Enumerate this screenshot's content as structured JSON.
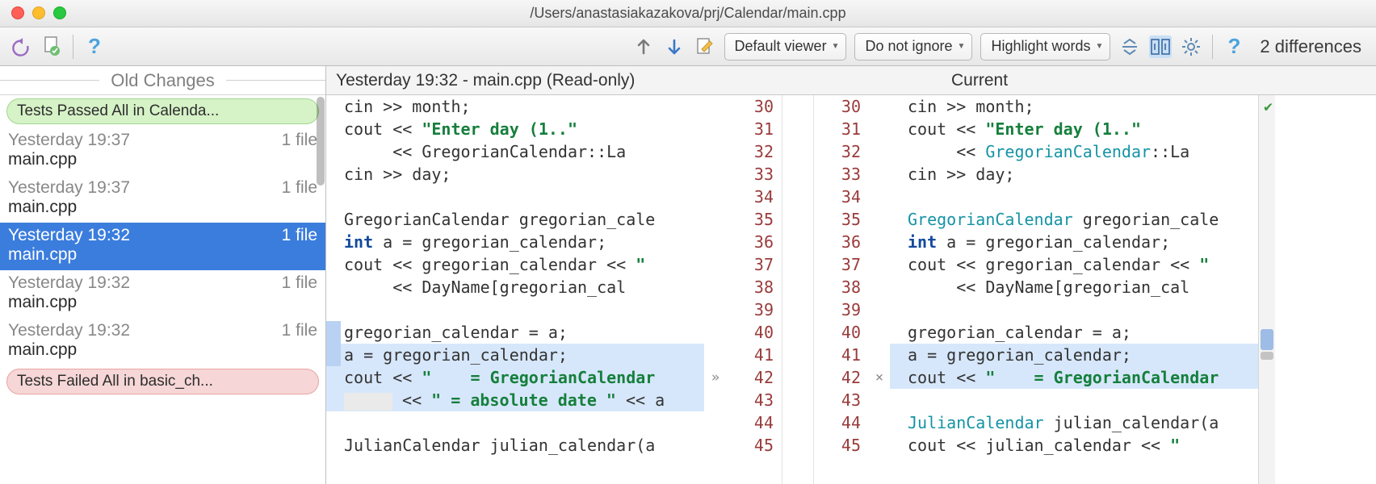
{
  "window": {
    "title": "/Users/anastasiakazakova/prj/Calendar/main.cpp"
  },
  "toolbar": {
    "viewer_dd": "Default viewer",
    "ignore_dd": "Do not ignore",
    "highlight_dd": "Highlight words",
    "diff_count": "2 differences"
  },
  "sidebar": {
    "header": "Old Changes",
    "pass_pill": "Tests Passed All in Calenda...",
    "fail_pill": "Tests Failed All in basic_ch...",
    "items": [
      {
        "time": "Yesterday 19:37",
        "files": "1 file",
        "name": "main.cpp",
        "sel": false
      },
      {
        "time": "Yesterday 19:37",
        "files": "1 file",
        "name": "main.cpp",
        "sel": false
      },
      {
        "time": "Yesterday 19:32",
        "files": "1 file",
        "name": "main.cpp",
        "sel": true
      },
      {
        "time": "Yesterday 19:32",
        "files": "1 file",
        "name": "main.cpp",
        "sel": false
      },
      {
        "time": "Yesterday 19:32",
        "files": "1 file",
        "name": "main.cpp",
        "sel": false
      }
    ]
  },
  "diff": {
    "left_header": "Yesterday 19:32 - main.cpp (Read-only)",
    "right_header": "Current",
    "lines_left": [
      {
        "n": "30",
        "html": "cin >> month;"
      },
      {
        "n": "31",
        "html": "cout << <span class='kw-str'>\"Enter day (1..\"</span>"
      },
      {
        "n": "32",
        "html": "     << GregorianCalendar::La",
        "fold": true
      },
      {
        "n": "33",
        "html": "cin >> day;"
      },
      {
        "n": "34",
        "html": ""
      },
      {
        "n": "35",
        "html": "GregorianCalendar gregorian_cale"
      },
      {
        "n": "36",
        "html": "<span class='kw-keyword'>int</span> a = gregorian_calendar;"
      },
      {
        "n": "37",
        "html": "cout << gregorian_calendar << <span class='kw-str'>\"</span>",
        "fold": true
      },
      {
        "n": "38",
        "html": "     << DayName[gregorian_cal"
      },
      {
        "n": "39",
        "html": ""
      },
      {
        "n": "40",
        "html": "gregorian_calendar = a;",
        "marker": "blue"
      },
      {
        "n": "41",
        "html": "a = gregorian_calendar;",
        "marker": "blue",
        "cls": "hl-change"
      },
      {
        "n": "42",
        "html": "cout << <span class='kw-str'>\"    = GregorianCalendar</span>",
        "cls": "hl-change",
        "arrow": "»"
      },
      {
        "n": "43",
        "html": "<span class='hl-blank'></span> << <span class='kw-str'>\" = absolute date \"</span> << a",
        "cls": "hl-extra"
      },
      {
        "n": "44",
        "html": ""
      },
      {
        "n": "45",
        "html": "JulianCalendar julian_calendar(a"
      }
    ],
    "lines_right": [
      {
        "n": "30",
        "html": "cin >> month;"
      },
      {
        "n": "31",
        "html": "cout << <span class='kw-str'>\"Enter day (1..\"</span>"
      },
      {
        "n": "32",
        "html": "     << <span class='kw-type'>GregorianCalendar</span>::La"
      },
      {
        "n": "33",
        "html": "cin >> day;",
        "fold": true
      },
      {
        "n": "34",
        "html": ""
      },
      {
        "n": "35",
        "html": "<span class='kw-type'>GregorianCalendar</span> gregorian_cale"
      },
      {
        "n": "36",
        "html": "<span class='kw-keyword'>int</span> a = gregorian_calendar;"
      },
      {
        "n": "37",
        "html": "cout << gregorian_calendar << <span class='kw-str'>\"</span>",
        "fold": true
      },
      {
        "n": "38",
        "html": "     << DayName[gregorian_cal"
      },
      {
        "n": "39",
        "html": ""
      },
      {
        "n": "40",
        "html": "gregorian_calendar = a;"
      },
      {
        "n": "41",
        "html": "a = gregorian_calendar;",
        "cls": "hl-change"
      },
      {
        "n": "42",
        "html": "cout << <span class='kw-str'>\"    = GregorianCalendar</span>",
        "cls": "hl-change",
        "x": "×"
      },
      {
        "n": "43",
        "html": ""
      },
      {
        "n": "44",
        "html": "<span class='kw-type'>JulianCalendar</span> julian_calendar(a"
      },
      {
        "n": "45",
        "html": "cout << julian_calendar << <span class='kw-str'>\"</span>"
      }
    ]
  }
}
